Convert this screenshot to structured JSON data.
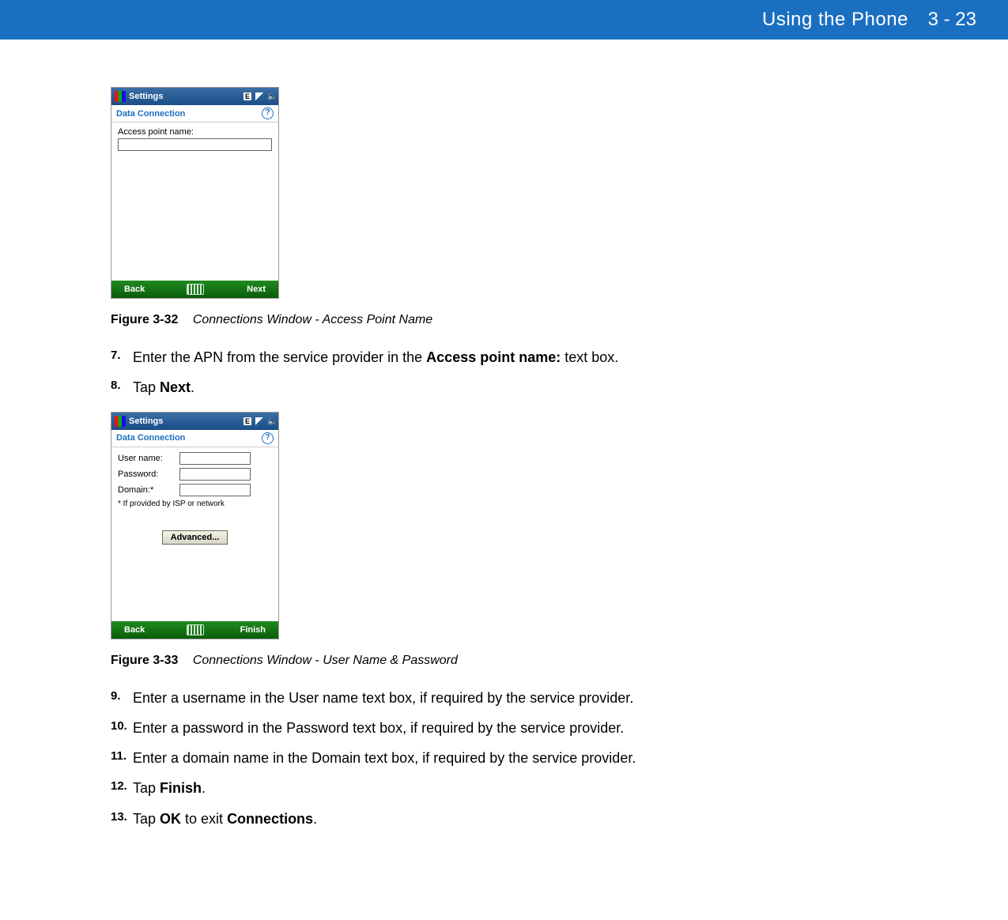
{
  "header": {
    "chapter": "Using the Phone",
    "page_ref": "3 - 23"
  },
  "fig1": {
    "label": "Figure 3-32",
    "title": "Connections Window - Access Point Name",
    "titlebar": "Settings",
    "e_badge": "E",
    "subhead": "Data Connection",
    "help_glyph": "?",
    "apn_label": "Access point name:",
    "soft_left": "Back",
    "soft_right": "Next"
  },
  "fig2": {
    "label": "Figure 3-33",
    "title": "Connections Window - User Name & Password",
    "titlebar": "Settings",
    "e_badge": "E",
    "subhead": "Data Connection",
    "help_glyph": "?",
    "user_label": "User name:",
    "pass_label": "Password:",
    "domain_label": "Domain:*",
    "footnote": "* If provided by ISP or network",
    "advanced_label": "Advanced...",
    "soft_left": "Back",
    "soft_right": "Finish"
  },
  "steps_a": [
    {
      "num": "7.",
      "pre": "Enter the APN from the service provider in the ",
      "bold": "Access point name:",
      "post": " text box."
    },
    {
      "num": "8.",
      "pre": "Tap ",
      "bold": "Next",
      "post": "."
    }
  ],
  "steps_b": [
    {
      "num": "9.",
      "text": "Enter a username in the User name text box, if required by the service provider."
    },
    {
      "num": "10.",
      "text": "Enter a password in the Password text box, if required by the service provider."
    },
    {
      "num": "11.",
      "text": "Enter a domain name in the Domain text box, if required by the service provider."
    },
    {
      "num": "12.",
      "pre": "Tap ",
      "bold": "Finish",
      "post": "."
    },
    {
      "num": "13.",
      "pre": "Tap ",
      "bold": "OK",
      "mid": " to exit ",
      "bold2": "Connections",
      "post": "."
    }
  ]
}
